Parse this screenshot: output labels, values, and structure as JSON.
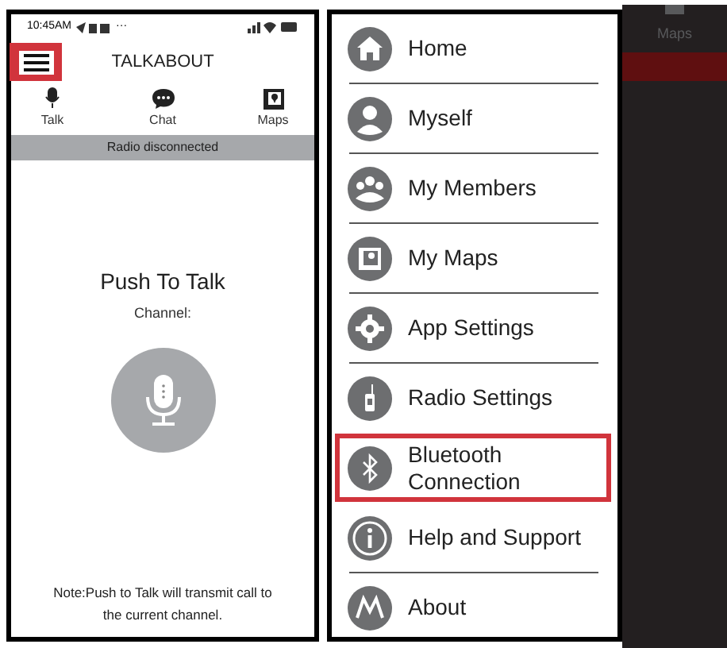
{
  "phone": {
    "status_bar": {
      "time": "10:45AM",
      "more": "···"
    },
    "header": {
      "title": "TALKABOUT",
      "menu_button": {
        "highlighted": true
      }
    },
    "tabs": [
      {
        "label": "Talk",
        "kind": "mic"
      },
      {
        "label": "Chat",
        "kind": "chat"
      },
      {
        "label": "Maps",
        "kind": "map"
      }
    ],
    "banner": "Radio disconnected",
    "heading": "Push To Talk",
    "channel_label": "Channel:",
    "note": "Note:Push to Talk will transmit call to the current channel."
  },
  "drawer": {
    "items": [
      {
        "label": "Home",
        "kind": "home",
        "highlighted": false
      },
      {
        "label": "Myself",
        "kind": "person",
        "highlighted": false
      },
      {
        "label": "My Members",
        "kind": "group",
        "highlighted": false
      },
      {
        "label": "My Maps",
        "kind": "map",
        "highlighted": false
      },
      {
        "label": "App Settings",
        "kind": "gear",
        "highlighted": false
      },
      {
        "label": "Radio Settings",
        "kind": "radio",
        "highlighted": false
      },
      {
        "label": "Bluetooth Connection",
        "kind": "bluetooth",
        "highlighted": true
      },
      {
        "label": "Help and Support",
        "kind": "info",
        "highlighted": false
      },
      {
        "label": "About",
        "kind": "logo",
        "highlighted": false
      }
    ]
  },
  "background_tab": {
    "label": "Maps"
  }
}
